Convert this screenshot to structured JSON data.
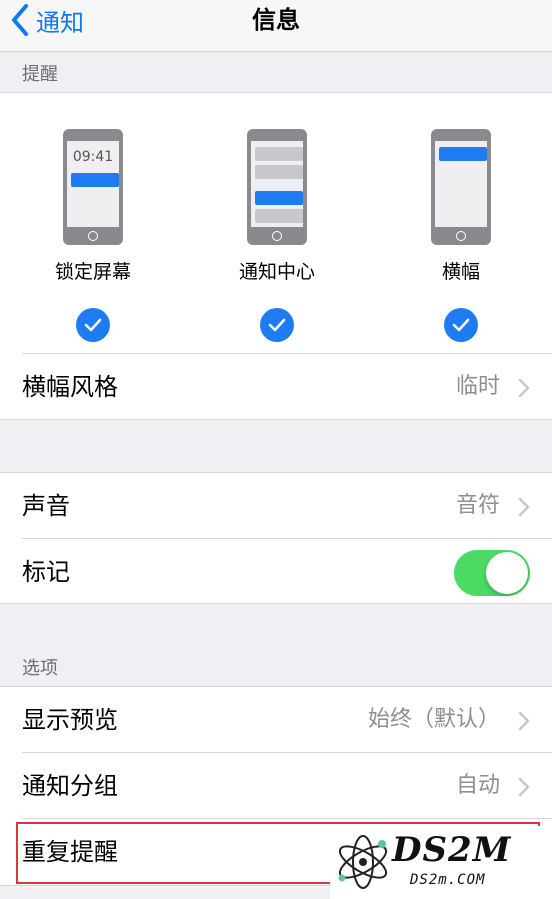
{
  "nav": {
    "back_label": "通知",
    "title": "信息"
  },
  "sections": {
    "alerts_header": "提醒",
    "options_header": "选项"
  },
  "alerts": {
    "lock_screen": {
      "label": "锁定屏幕",
      "time": "09:41",
      "checked": true
    },
    "notification_center": {
      "label": "通知中心",
      "checked": true
    },
    "banners": {
      "label": "横幅",
      "checked": true
    }
  },
  "banner_style": {
    "label": "横幅风格",
    "value": "临时"
  },
  "sounds": {
    "label": "声音",
    "value": "音符"
  },
  "badges": {
    "label": "标记",
    "enabled": true
  },
  "show_previews": {
    "label": "显示预览",
    "value": "始终（默认）"
  },
  "grouping": {
    "label": "通知分组",
    "value": "自动"
  },
  "repeat_alerts": {
    "label": "重复提醒"
  },
  "watermark": {
    "brand": "DS2M",
    "site": "DS2m.COM"
  },
  "colors": {
    "accent": "#0a7aff",
    "toggle_on": "#4cd964",
    "highlight": "#d9363e"
  }
}
